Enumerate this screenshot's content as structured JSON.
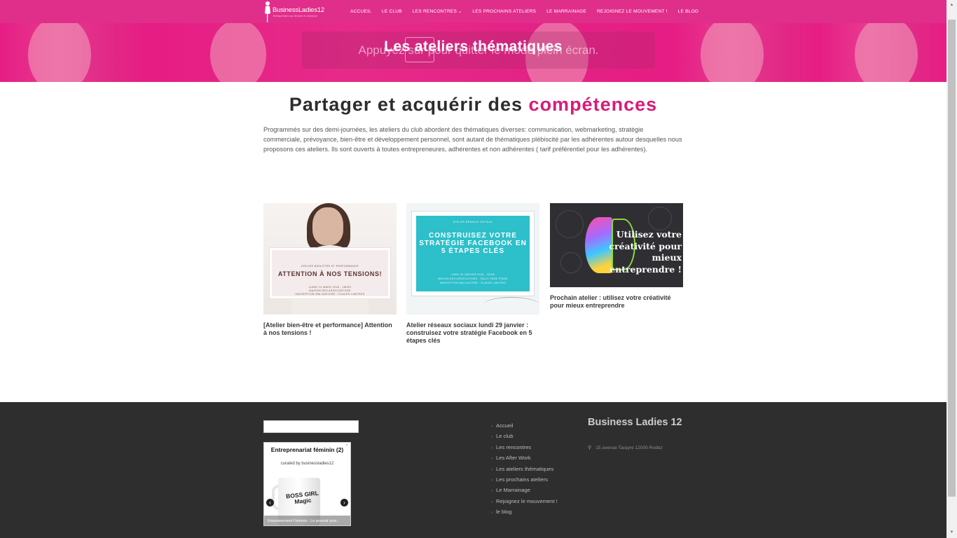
{
  "header": {
    "logo_text": "BusinessLadies12",
    "logo_tagline": "Entreprendre au féminin en Aveyron",
    "nav": [
      {
        "label": "ACCUEIL"
      },
      {
        "label": "LE CLUB"
      },
      {
        "label": "LES RENCONTRES",
        "caret": "⌄"
      },
      {
        "label": "LES PROCHAINS ATELIERS"
      },
      {
        "label": "LE MARRAINAGE"
      },
      {
        "label": "REJOIGNEZ LE MOUVEMENT !"
      },
      {
        "label": "LE BLOG"
      }
    ]
  },
  "hero": {
    "fullscreen_notice": "Appuyez sur       pour quitter le mode plein écran.",
    "title": "Les ateliers thématiques"
  },
  "main": {
    "heading_start": "Partager et acquérir des",
    "heading_accent": "compétences",
    "intro": "Programmés sur des demi-journées, les ateliers du club abordent des thématiques diverses: communication, webmarketing, stratégie commerciale, prévoyance, bien-être et développement personnel, sont autant de thématiques plébiscité par les adhérentes autour desquelles nous proposons ces ateliers. Ils sont ouverts à toutes entrepreneures, adhérentes et non adhérentes ( tarif préférentiel pour les adhérentes).",
    "cards": [
      {
        "title": "[Atelier bien-être et performance] Attention à nos tensions !",
        "img_top": "ATELIER BIEN-ÊTRE ET PERFORMANCE",
        "img_big": "ATTENTION À NOS TENSIONS!",
        "img_line1": "LUNDI 12 MARS 2018 - 18H00",
        "img_line2": "MAISON DES ASSOCIATIONS",
        "img_line3": "INSCRIPTION OBLIGATOIRE - PLACES LIMITÉES"
      },
      {
        "title": "Atelier réseaux sociaux lundi 29 janvier : construisez votre stratégie Facebook en 5 étapes clés",
        "img_top": "ATELIER RÉSEAUX SOCIAUX",
        "img_big": "CONSTRUISEZ VOTRE STRATÉGIE FACEBOOK EN 5 ÉTAPES CLÉS",
        "img_line1": "LUNDI 29 JANVIER 2018 - 18H00",
        "img_line2": "MAISON DES ASSOCIATIONS - SALLE 3ÈME ÉTAGE",
        "img_line3": "INSCRIPTION OBLIGATOIRE - PLACES LIMITÉES"
      },
      {
        "title": "Prochain atelier : utilisez votre créativité pour mieux entreprendre",
        "img_big": "Utilisez votre créativité pour mieux entreprendre !"
      }
    ]
  },
  "footer": {
    "widget": {
      "title": "Entreprenariat féminin (2)",
      "curated": "curated by businessladies12",
      "mug_text": "BOSS GIRL Magic",
      "caption": "Empowerment Féminin : Le pouvoir posi...",
      "close": "×",
      "prev": "‹",
      "next": "›"
    },
    "links": [
      "Accueil",
      "Le club",
      "Les rencontres",
      "Les After Work",
      "Les ateliers thématiques",
      "Les prochains ateliers",
      "Le Marrainage",
      "Rejoignez le mouvement !",
      "le blog"
    ],
    "org_name": "Business Ladies 12",
    "address": "15 avenue Tarayre 12000 Rodez"
  },
  "colors": {
    "brand_pink": "#e61d84",
    "accent_pink": "#d81b78",
    "footer_bg": "#2e2e2e",
    "facebook_teal": "#2dbfca"
  },
  "icons": {
    "link_bullet": "chevron-right-icon",
    "address": "map-pin-icon",
    "nav_dropdown": "chevron-down-icon"
  }
}
